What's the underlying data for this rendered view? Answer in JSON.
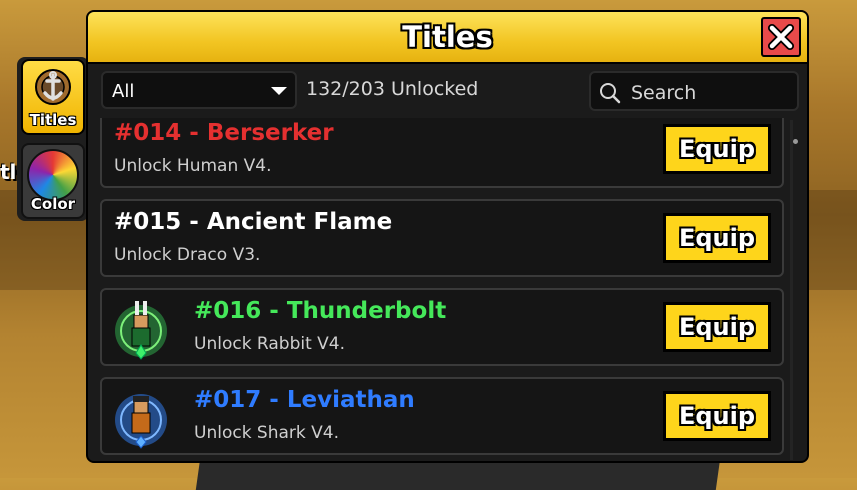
{
  "side": {
    "partial_text": "tle"
  },
  "tabs": [
    {
      "label": "Titles",
      "icon": "anchor-medal-icon",
      "active": true
    },
    {
      "label": "Color",
      "icon": "color-wheel-icon",
      "active": false
    }
  ],
  "panel": {
    "title": "Titles",
    "filter_value": "All",
    "unlocked_count": "132/203 Unlocked",
    "search_placeholder": "Search"
  },
  "titles": [
    {
      "name": "#014 - Berserker",
      "desc": "Unlock Human V4.",
      "color": "#e53030",
      "equip": "Equip",
      "has_avatar": false
    },
    {
      "name": "#015 - Ancient Flame",
      "desc": "Unlock Draco V3.",
      "color": "#ffffff",
      "equip": "Equip",
      "has_avatar": false
    },
    {
      "name": "#016 - Thunderbolt",
      "desc": "Unlock Rabbit V4.",
      "color": "#45e85a",
      "equip": "Equip",
      "has_avatar": true,
      "avatar_color": "#2fa84a"
    },
    {
      "name": "#017 - Leviathan",
      "desc": "Unlock Shark V4.",
      "color": "#2f7cff",
      "equip": "Equip",
      "has_avatar": true,
      "avatar_color": "#2d6fd6"
    }
  ],
  "colors": {
    "accent": "#f2c522",
    "equip_bg": "#fed51b",
    "close_bg": "#e84a4a"
  }
}
